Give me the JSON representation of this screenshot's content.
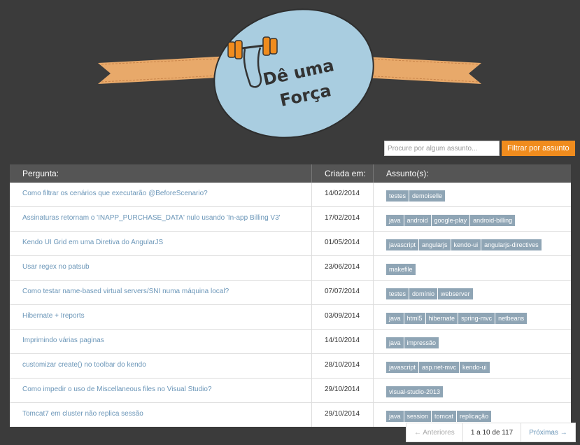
{
  "logo": {
    "line1": "Dê uma",
    "line2": "Força"
  },
  "search": {
    "placeholder": "Procure por algum assunto...",
    "button_label": "Filtrar por assunto"
  },
  "table": {
    "headers": {
      "question": "Pergunta:",
      "created": "Criada em:",
      "tags": "Assunto(s):"
    },
    "rows": [
      {
        "title": "Como filtrar os cenários que executarão @BeforeScenario?",
        "date": "14/02/2014",
        "tags": [
          "testes",
          "demoiselle"
        ]
      },
      {
        "title": "Assinaturas retornam o 'INAPP_PURCHASE_DATA' nulo usando 'In-app Billing V3'",
        "date": "17/02/2014",
        "tags": [
          "java",
          "android",
          "google-play",
          "android-billing"
        ]
      },
      {
        "title": "Kendo UI Grid em uma Diretiva do AngularJS",
        "date": "01/05/2014",
        "tags": [
          "javascript",
          "angularjs",
          "kendo-ui",
          "angularjs-directives"
        ]
      },
      {
        "title": "Usar regex no patsub",
        "date": "23/06/2014",
        "tags": [
          "makefile"
        ]
      },
      {
        "title": "Como testar name-based virtual servers/SNI numa máquina local?",
        "date": "07/07/2014",
        "tags": [
          "testes",
          "domínio",
          "webserver"
        ]
      },
      {
        "title": "Hibernate + Ireports",
        "date": "03/09/2014",
        "tags": [
          "java",
          "html5",
          "hibernate",
          "spring-mvc",
          "netbeans"
        ]
      },
      {
        "title": "Imprimindo várias paginas",
        "date": "14/10/2014",
        "tags": [
          "java",
          "impressão"
        ]
      },
      {
        "title": "customizar create() no toolbar do kendo",
        "date": "28/10/2014",
        "tags": [
          "javascript",
          "asp.net-mvc",
          "kendo-ui"
        ]
      },
      {
        "title": "Como impedir o uso de Miscellaneous files no Visual Studio?",
        "date": "29/10/2014",
        "tags": [
          "visual-studio-2013"
        ]
      },
      {
        "title": "Tomcat7 em cluster não replica sessão",
        "date": "29/10/2014",
        "tags": [
          "java",
          "session",
          "tomcat",
          "replicação"
        ]
      }
    ]
  },
  "pagination": {
    "prev": "← Anteriores",
    "info": "1 a 10 de 117",
    "next": "Próximas →"
  },
  "colors": {
    "background": "#3b3b3b",
    "accent": "#f08c1e",
    "tag": "#8fa5b5",
    "link": "#6b96b8",
    "logo_oval": "#a9cde0",
    "ribbon": "#e8a96a"
  }
}
